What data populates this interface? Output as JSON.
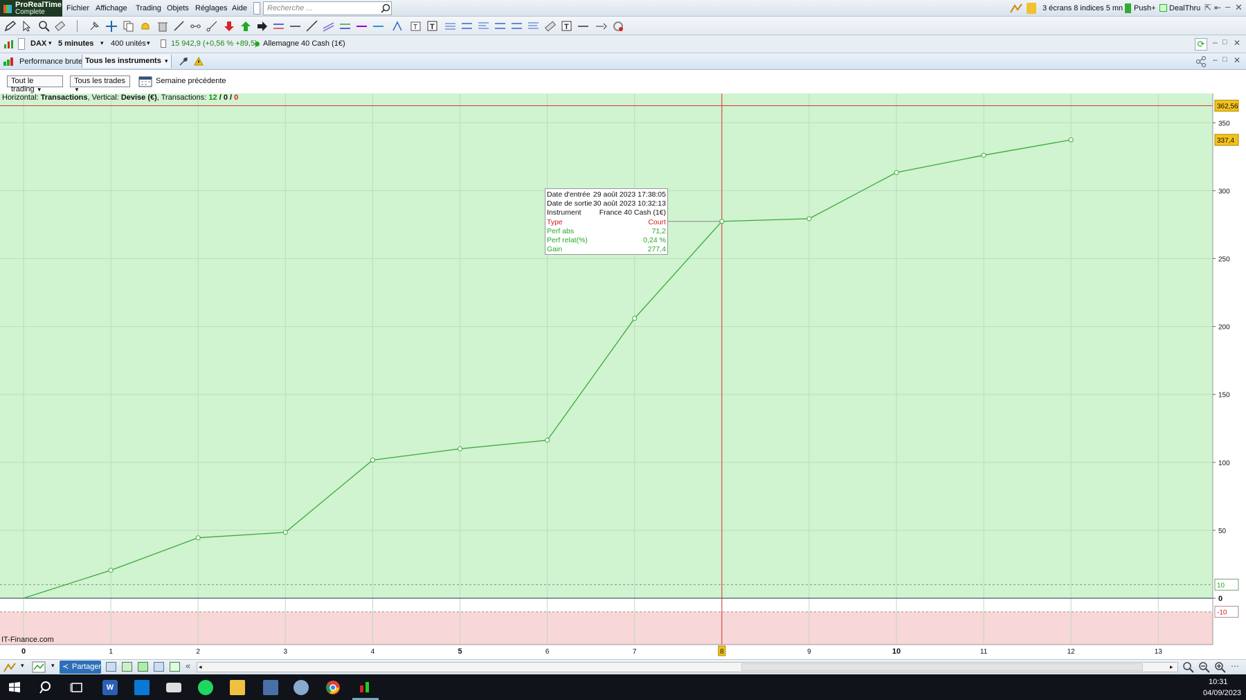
{
  "menubar": {
    "logo_line1": "ProRealTime",
    "logo_line2": "Complete",
    "items": [
      "Fichier",
      "Affichage",
      "Trading",
      "Objets",
      "Réglages",
      "Aide"
    ],
    "search_placeholder": "Recherche ...",
    "layout": "3 écrans 8 indices 5 mn",
    "push": "Push+",
    "dealthru": "DealThru"
  },
  "instrbar": {
    "symbol": "DAX",
    "timeframe": "5 minutes",
    "units": "400 unités",
    "quote": "15 942,9 (+0,56 % +89,5)",
    "instrument": "Allemagne 40 Cash (1€)"
  },
  "perfbar": {
    "tab_label": "Performance brute",
    "instruments": "Tous les instruments"
  },
  "filters": {
    "trading": "Tout le trading",
    "trades": "Tous les trades",
    "period": "Semaine précédente"
  },
  "status": {
    "h_label": "Horizontal:",
    "h_value": "Transactions",
    "v_label": ", Vertical:",
    "v_value": "Devise (€)",
    "t_label": ", Transactions:",
    "t_total": "12",
    "sep1": " / ",
    "t_mid": "0",
    "sep2": " / ",
    "t_last": "0"
  },
  "watermark": "IT-Finance.com",
  "tooltip": {
    "rows": [
      {
        "label": "Date d'entrée",
        "value": "29 août 2023 17:38:05"
      },
      {
        "label": "Date de sortie",
        "value": "30 août 2023 10:32:13"
      },
      {
        "label": "Instrument",
        "value": "France 40 Cash (1€)"
      },
      {
        "label": "Type",
        "value": "Court"
      },
      {
        "label": "Perf abs",
        "value": "71,2"
      },
      {
        "label": "Perf relat(%)",
        "value": "0,24 %"
      },
      {
        "label": "Gain",
        "value": "277,4"
      }
    ]
  },
  "chart_data": {
    "type": "line",
    "x": [
      0,
      1,
      2,
      3,
      4,
      5,
      6,
      7,
      8,
      9,
      10,
      11,
      12
    ],
    "y": [
      0,
      20.6,
      44.5,
      48.5,
      101.7,
      110,
      116.3,
      206,
      277.4,
      279.4,
      313.4,
      326.1,
      337.4
    ],
    "xlim": [
      0,
      13
    ],
    "ylim": [
      -10,
      362.56
    ],
    "yticks": [
      0,
      50,
      100,
      150,
      200,
      250,
      300,
      350
    ],
    "xticks": [
      0,
      1,
      2,
      3,
      4,
      5,
      6,
      7,
      8,
      9,
      10,
      11,
      12,
      13
    ],
    "bold_xticks": [
      0,
      5,
      10
    ],
    "upper_line": 362.56,
    "upper_label": "362,56",
    "last_label": "337,4",
    "band_plus": "10",
    "band_minus": "-10",
    "selected_x": 8,
    "colors": {
      "profit_zone": "#d0f3d0",
      "loss_zone": "#f7d7d7",
      "line": "#3aaa3a",
      "marker": "#d23"
    }
  },
  "bottombar": {
    "share": "Partager"
  },
  "taskbar": {
    "time": "10:31",
    "date": "04/09/2023"
  }
}
